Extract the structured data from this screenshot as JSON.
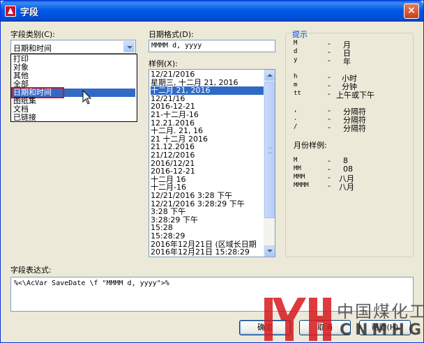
{
  "window": {
    "title": "字段",
    "close_glyph": "×"
  },
  "category": {
    "label": "字段类别(C):",
    "selected": "日期和时间",
    "options": [
      "打印",
      "对象",
      "其他",
      "全部",
      "日期和时间",
      "图纸集",
      "文档",
      "已链接"
    ],
    "selected_index": 4
  },
  "format": {
    "label": "日期格式(D):",
    "value": "MMMM d, yyyy"
  },
  "samples": {
    "label": "样例(X):",
    "items": [
      "12/21/2016",
      "星期三, 十二月 21, 2016",
      "十二月 21, 2016",
      "12/21/16",
      "2016-12-21",
      "21-十二月-16",
      "12.21.2016",
      "十二月. 21, 16",
      "21 十二月 2016",
      "21.12.2016",
      "21/12/2016",
      "2016/12/21",
      "2016-12-21",
      "十二月 16",
      "十二月-16",
      "12/21/2016 3:28 下午",
      "12/21/2016 3:28:29 下午",
      "3:28 下午",
      "3:28:29 下午",
      "15:28",
      "15:28:29",
      "2016年12月21日 (区域长日期",
      "2016年12月21日 15:28:29"
    ],
    "selected_index": 2
  },
  "hints": {
    "title": "提示",
    "rows": [
      {
        "code": "M",
        "dash": "-",
        "desc": "月"
      },
      {
        "code": "d",
        "dash": "-",
        "desc": "日"
      },
      {
        "code": "y",
        "dash": "-",
        "desc": "年"
      },
      {
        "code": "h",
        "dash": "-",
        "desc": "小时"
      },
      {
        "code": "m",
        "dash": "-",
        "desc": "分钟"
      },
      {
        "code": "tt",
        "dash": "-",
        "desc": "上午或下午"
      },
      {
        "code": ",",
        "dash": "-",
        "desc": "分隔符"
      },
      {
        "code": ".",
        "dash": "-",
        "desc": "分隔符"
      },
      {
        "code": "/",
        "dash": "-",
        "desc": "分隔符"
      }
    ],
    "month_title": "月份样例:",
    "month_rows": [
      {
        "code": "M",
        "dash": "-",
        "desc": "8"
      },
      {
        "code": "MM",
        "dash": "-",
        "desc": "08"
      },
      {
        "code": "MMM",
        "dash": "-",
        "desc": "八月"
      },
      {
        "code": "MMMM",
        "dash": "-",
        "desc": "八月"
      }
    ]
  },
  "expression": {
    "label": "字段表达式:",
    "value": "%<\\AcVar SaveDate \\f \"MMMM d, yyyy\">%"
  },
  "buttons": {
    "ok": "确定",
    "cancel": "取消",
    "help": "帮助(H)"
  },
  "watermark": {
    "cn": "中国煤化工",
    "en": "CNMHG",
    "logo": "YH"
  }
}
